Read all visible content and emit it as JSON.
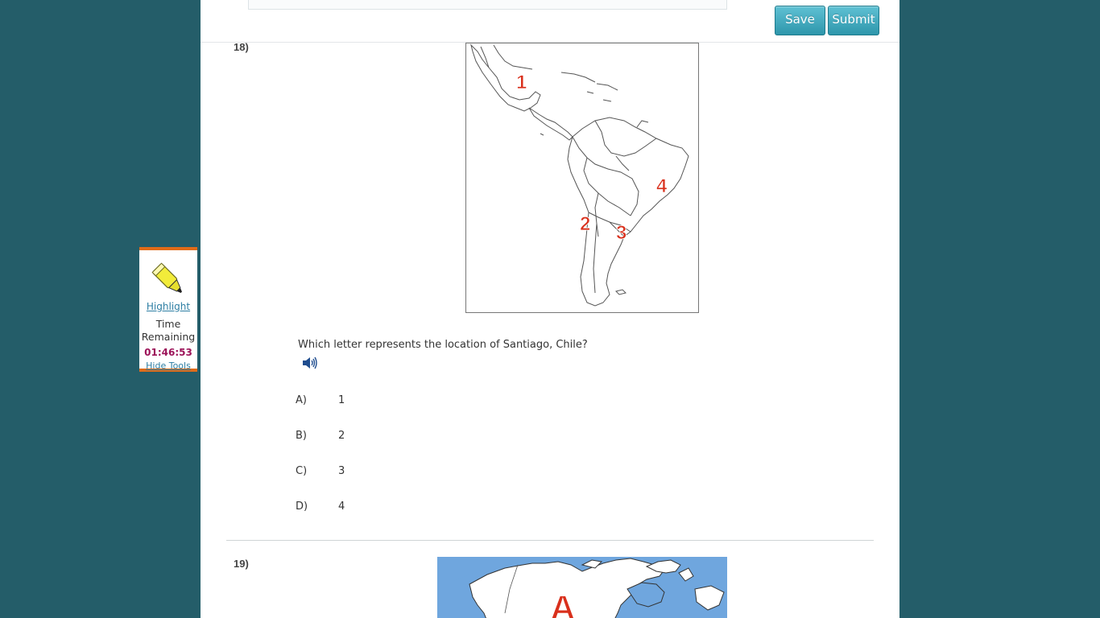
{
  "toolbar": {
    "save_label": "Save",
    "submit_label": "Submit"
  },
  "question18": {
    "number": "18)",
    "map_markers": [
      "1",
      "2",
      "3",
      "4"
    ],
    "stem": "Which letter represents the location of Santiago, Chile?",
    "choices": [
      {
        "letter": "A)",
        "value": "1"
      },
      {
        "letter": "B)",
        "value": "2"
      },
      {
        "letter": "C)",
        "value": "3"
      },
      {
        "letter": "D)",
        "value": "4"
      }
    ]
  },
  "question19": {
    "number": "19)",
    "map_marker": "A"
  },
  "tools": {
    "highlight_label": "Highlight",
    "time_label": "Time Remaining",
    "time_value": "01:46:53",
    "hide_label": "Hide Tools"
  },
  "colors": {
    "background": "#245d69",
    "button": "#3aa3b8",
    "marker": "#d9301c",
    "timer": "#9c1359",
    "toolbox_border": "#e06b18"
  }
}
